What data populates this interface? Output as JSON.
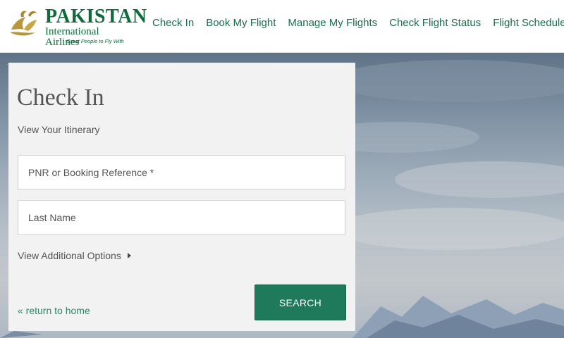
{
  "header": {
    "logo": {
      "name": "PAKISTAN",
      "subtitle": "International Airlines",
      "tagline": "Great People to Fly With"
    },
    "nav": [
      {
        "label": "Check In"
      },
      {
        "label": "Book My Flight"
      },
      {
        "label": "Manage My Flights"
      },
      {
        "label": "Check Flight Status"
      },
      {
        "label": "Flight Schedules"
      }
    ]
  },
  "checkin": {
    "title": "Check In",
    "subtitle": "View Your Itinerary",
    "pnr_placeholder": "PNR or Booking Reference *",
    "lastname_placeholder": "Last Name",
    "additional_options": "View Additional Options",
    "return_link": "« return to home",
    "search_label": "SEARCH"
  },
  "colors": {
    "brand_green": "#0f6b3b",
    "nav_green": "#1a6e4a",
    "button_green": "#1f7a5c",
    "link_green": "#2a8a68"
  }
}
